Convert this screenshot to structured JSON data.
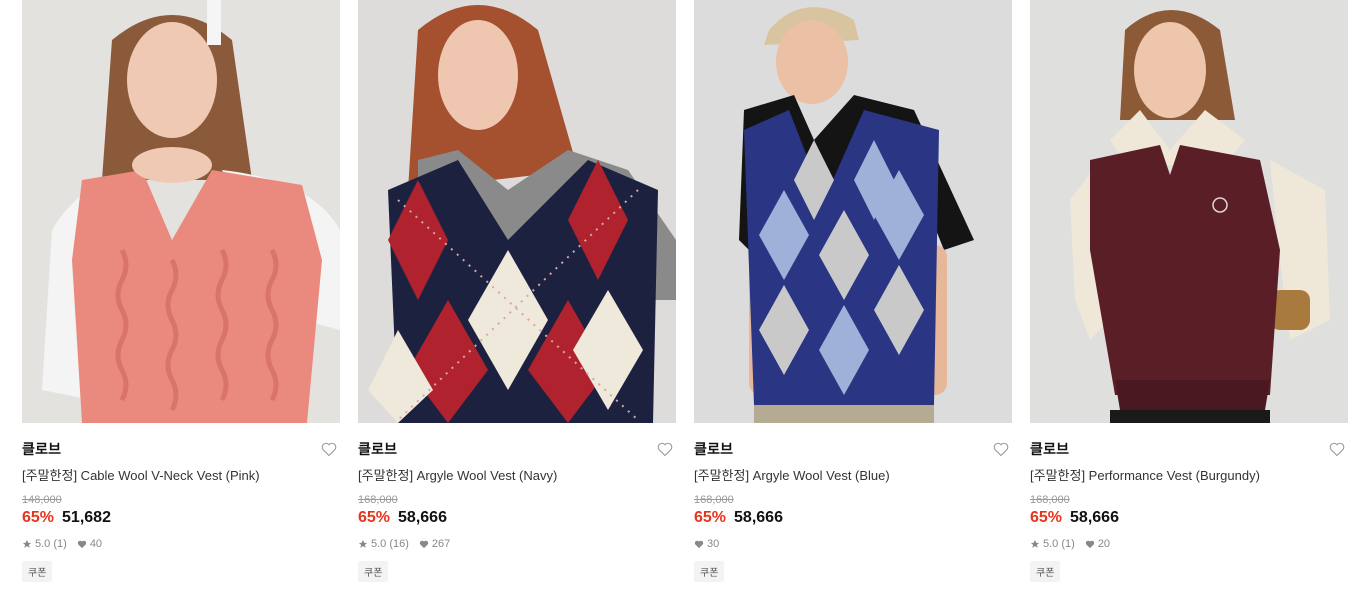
{
  "products": [
    {
      "brand": "클로브",
      "name": "[주말한정] Cable Wool V-Neck Vest (Pink)",
      "original_price": "148,000",
      "discount": "65%",
      "price": "51,682",
      "rating": "5.0",
      "reviews": "(1)",
      "likes": "40",
      "coupon": "쿠폰",
      "colors": {
        "bg": "#e4e2df",
        "garment": "#ea8a7e",
        "inner": "#f4f4f4",
        "accent": "#c96a60"
      }
    },
    {
      "brand": "클로브",
      "name": "[주말한정] Argyle Wool Vest (Navy)",
      "original_price": "168,000",
      "discount": "65%",
      "price": "58,666",
      "rating": "5.0",
      "reviews": "(16)",
      "likes": "267",
      "coupon": "쿠폰",
      "colors": {
        "bg": "#dddcda",
        "garment": "#1c2140",
        "inner": "#8a8a8a",
        "accent": "#b0222d"
      }
    },
    {
      "brand": "클로브",
      "name": "[주말한정] Argyle Wool Vest (Blue)",
      "original_price": "168,000",
      "discount": "65%",
      "price": "58,666",
      "rating": "",
      "reviews": "",
      "likes": "30",
      "coupon": "쿠폰",
      "colors": {
        "bg": "#dcdcdc",
        "garment": "#2a3583",
        "inner": "#141414",
        "accent": "#9fb0d9"
      }
    },
    {
      "brand": "클로브",
      "name": "[주말한정] Performance Vest (Burgundy)",
      "original_price": "168,000",
      "discount": "65%",
      "price": "58,666",
      "rating": "5.0",
      "reviews": "(1)",
      "likes": "20",
      "coupon": "쿠폰",
      "colors": {
        "bg": "#dfdfdd",
        "garment": "#5a1e26",
        "inner": "#efe8d8",
        "accent": "#a97a3e"
      }
    }
  ]
}
